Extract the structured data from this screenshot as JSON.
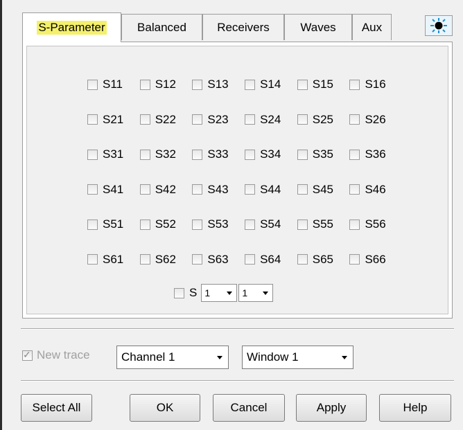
{
  "tabs": [
    {
      "label": "S-Parameter",
      "active": true
    },
    {
      "label": "Balanced"
    },
    {
      "label": "Receivers"
    },
    {
      "label": "Waves"
    },
    {
      "label": "Aux"
    }
  ],
  "corner_icon": "light-burst-icon",
  "s_matrix": [
    [
      "S11",
      "S12",
      "S13",
      "S14",
      "S15",
      "S16"
    ],
    [
      "S21",
      "S22",
      "S23",
      "S24",
      "S25",
      "S26"
    ],
    [
      "S31",
      "S32",
      "S33",
      "S34",
      "S35",
      "S36"
    ],
    [
      "S41",
      "S42",
      "S43",
      "S44",
      "S45",
      "S46"
    ],
    [
      "S51",
      "S52",
      "S53",
      "S54",
      "S55",
      "S56"
    ],
    [
      "S61",
      "S62",
      "S63",
      "S64",
      "S65",
      "S66"
    ]
  ],
  "custom_s": {
    "label": "S",
    "port1": "1",
    "port2": "1"
  },
  "new_trace": {
    "label": "New trace",
    "checked": true,
    "disabled": true
  },
  "channel_select": "Channel 1",
  "window_select": "Window 1",
  "buttons": {
    "select_all": "Select All",
    "ok": "OK",
    "cancel": "Cancel",
    "apply": "Apply",
    "help": "Help"
  }
}
